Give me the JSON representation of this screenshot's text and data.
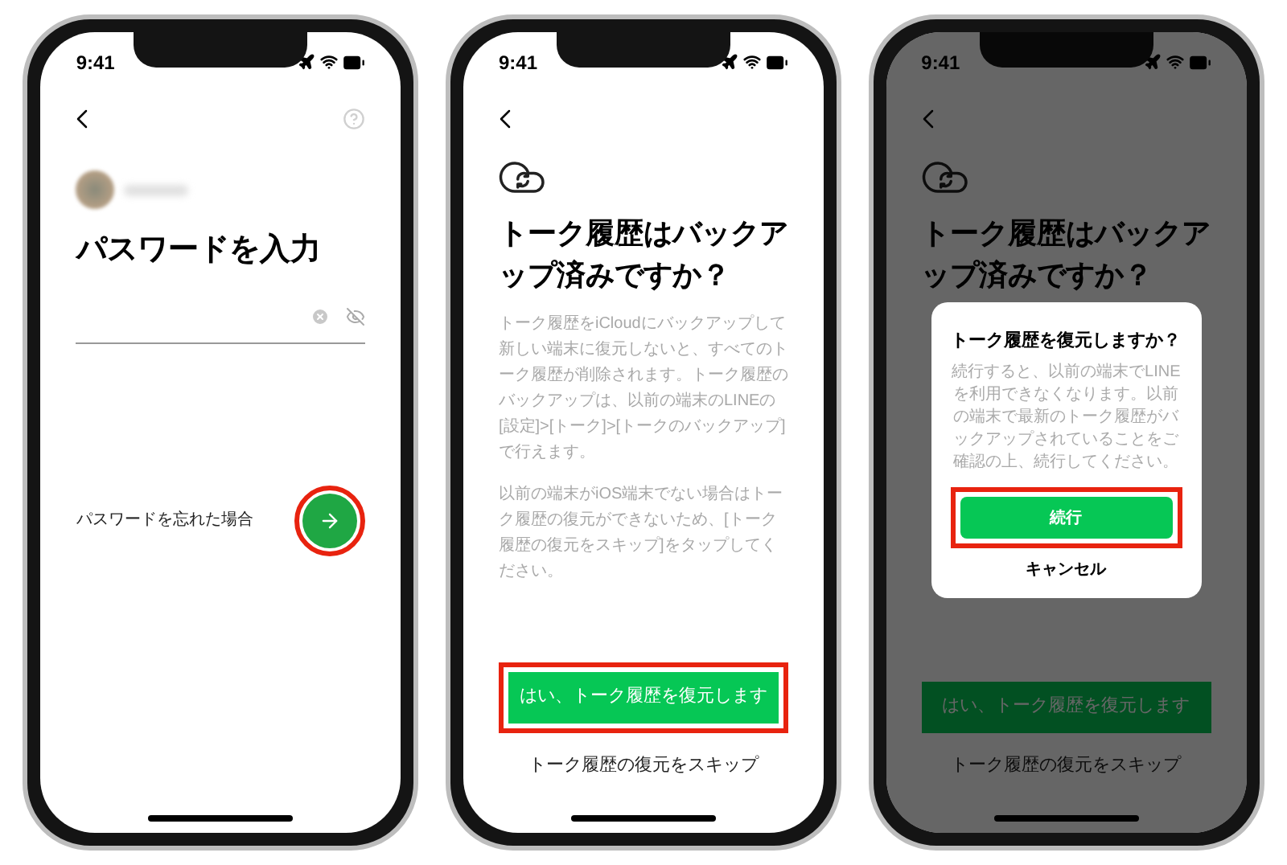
{
  "phones": [
    {
      "kind": "password",
      "status_time": "9:41",
      "dimmed": false,
      "title": "パスワードを入力",
      "forgot_link": "パスワードを忘れた場合",
      "next_button": {
        "highlighted": true
      }
    },
    {
      "kind": "backup",
      "status_time": "9:41",
      "dimmed": false,
      "title": "トーク履歴はバックアップ済みですか？",
      "paragraphs": [
        "トーク履歴をiCloudにバックアップして新しい端末に復元しないと、すべてのトーク履歴が削除されます。トーク履歴のバックアップは、以前の端末のLINEの[設定]>[トーク]>[トークのバックアップ]で行えます。",
        "以前の端末がiOS端末でない場合はトーク履歴の復元ができないため、[トーク履歴の復元をスキップ]をタップしてください。"
      ],
      "primary_button": {
        "label": "はい、トーク履歴を復元します",
        "highlighted": true
      },
      "skip_link": "トーク履歴の復元をスキップ"
    },
    {
      "kind": "backup",
      "status_time": "9:41",
      "dimmed": true,
      "title": "トーク履歴はバックアップ済みですか？",
      "primary_button": {
        "label": "はい、トーク履歴を復元します",
        "highlighted": false
      },
      "skip_link": "トーク履歴の復元をスキップ",
      "dialog": {
        "title": "トーク履歴を復元しますか？",
        "message": "続行すると、以前の端末でLINEを利用できなくなります。以前の端末で最新のトーク履歴がバックアップされていることをご確認の上、続行してください。",
        "confirm_button": {
          "label": "続行",
          "highlighted": true
        },
        "cancel_button": "キャンセル"
      }
    }
  ]
}
